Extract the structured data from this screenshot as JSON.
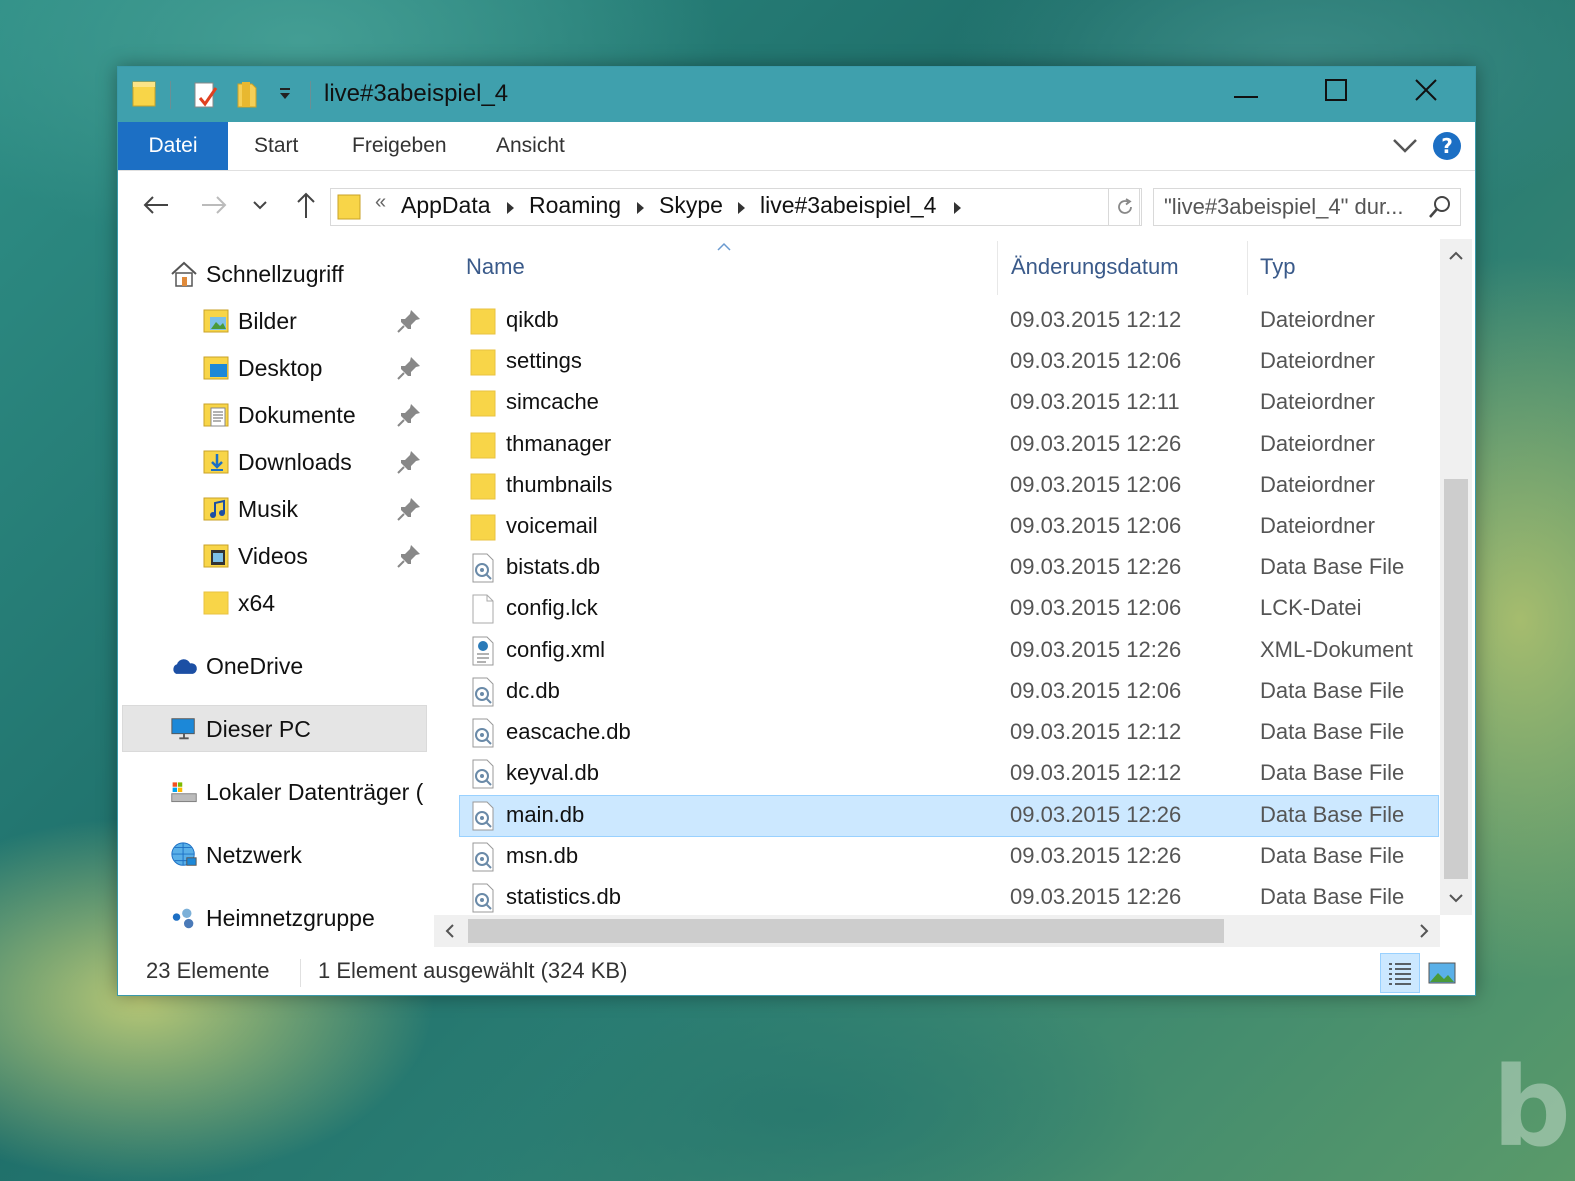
{
  "window": {
    "title": "live#3abeispiel_4"
  },
  "ribbon": {
    "tabs": [
      "Datei",
      "Start",
      "Freigeben",
      "Ansicht"
    ]
  },
  "address": {
    "overflow": "«",
    "crumbs": [
      "AppData",
      "Roaming",
      "Skype",
      "live#3abeispiel_4"
    ]
  },
  "search": {
    "placeholder": "\"live#3abeispiel_4\" dur..."
  },
  "sidebar": {
    "quick_access": "Schnellzugriff",
    "items": [
      "Bilder",
      "Desktop",
      "Dokumente",
      "Downloads",
      "Musik",
      "Videos",
      "x64"
    ],
    "onedrive": "OneDrive",
    "this_pc": "Dieser PC",
    "local_disk": "Lokaler Datenträger (",
    "network": "Netzwerk",
    "homegroup": "Heimnetzgruppe"
  },
  "columns": {
    "name": "Name",
    "date": "Änderungsdatum",
    "type": "Typ"
  },
  "files": [
    {
      "name": "qikdb",
      "date": "09.03.2015 12:12",
      "type": "Dateiordner",
      "icon": "folder"
    },
    {
      "name": "settings",
      "date": "09.03.2015 12:06",
      "type": "Dateiordner",
      "icon": "folder"
    },
    {
      "name": "simcache",
      "date": "09.03.2015 12:11",
      "type": "Dateiordner",
      "icon": "folder"
    },
    {
      "name": "thmanager",
      "date": "09.03.2015 12:26",
      "type": "Dateiordner",
      "icon": "folder"
    },
    {
      "name": "thumbnails",
      "date": "09.03.2015 12:06",
      "type": "Dateiordner",
      "icon": "folder"
    },
    {
      "name": "voicemail",
      "date": "09.03.2015 12:06",
      "type": "Dateiordner",
      "icon": "folder"
    },
    {
      "name": "bistats.db",
      "date": "09.03.2015 12:26",
      "type": "Data Base File",
      "icon": "db"
    },
    {
      "name": "config.lck",
      "date": "09.03.2015 12:06",
      "type": "LCK-Datei",
      "icon": "blank"
    },
    {
      "name": "config.xml",
      "date": "09.03.2015 12:26",
      "type": "XML-Dokument",
      "icon": "xml"
    },
    {
      "name": "dc.db",
      "date": "09.03.2015 12:06",
      "type": "Data Base File",
      "icon": "db"
    },
    {
      "name": "eascache.db",
      "date": "09.03.2015 12:12",
      "type": "Data Base File",
      "icon": "db"
    },
    {
      "name": "keyval.db",
      "date": "09.03.2015 12:12",
      "type": "Data Base File",
      "icon": "db"
    },
    {
      "name": "main.db",
      "date": "09.03.2015 12:26",
      "type": "Data Base File",
      "icon": "db",
      "selected": true
    },
    {
      "name": "msn.db",
      "date": "09.03.2015 12:26",
      "type": "Data Base File",
      "icon": "db"
    },
    {
      "name": "statistics.db",
      "date": "09.03.2015 12:26",
      "type": "Data Base File",
      "icon": "db"
    }
  ],
  "status": {
    "count": "23 Elemente",
    "selection": "1 Element ausgewählt (324 KB)"
  },
  "colors": {
    "titlebar": "#3fa0ad",
    "accent": "#1c6fc4",
    "selection": "#cce8ff",
    "folder": "#f8d548"
  }
}
